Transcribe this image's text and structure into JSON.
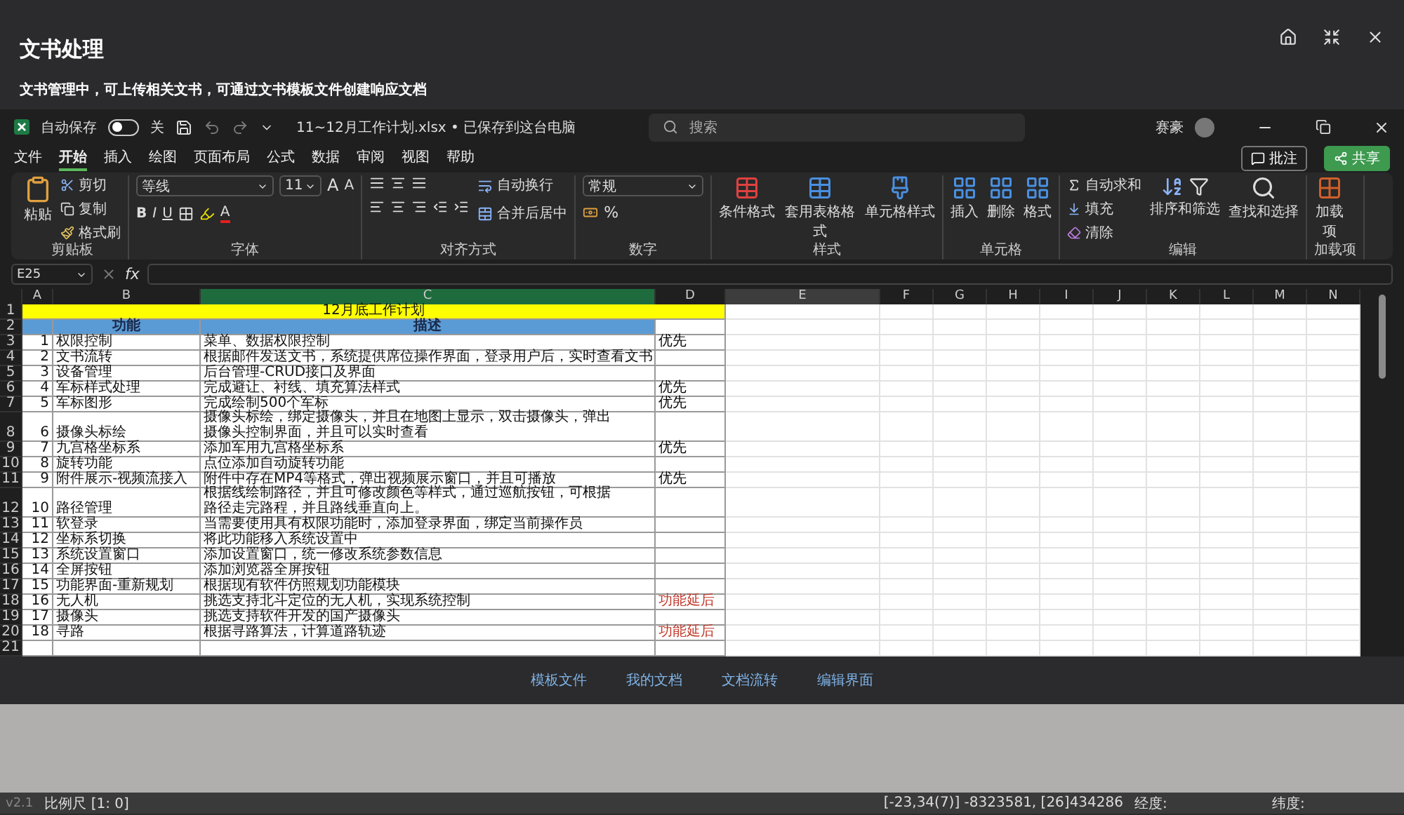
{
  "header": {
    "title": "文书处理",
    "subtitle": "文书管理中，可上传相关文书，可通过文书模板文件创建响应文档"
  },
  "excel": {
    "autosave": {
      "label": "自动保存",
      "on": false,
      "state_label": "关"
    },
    "filename": "11~12月工作计划.xlsx • 已保存到这台电脑",
    "search": {
      "placeholder": "搜索"
    },
    "user": "赛豪",
    "menu_tabs": [
      {
        "label": "文件",
        "selected": false
      },
      {
        "label": "开始",
        "selected": true
      },
      {
        "label": "插入",
        "selected": false
      },
      {
        "label": "绘图",
        "selected": false
      },
      {
        "label": "页面布局",
        "selected": false
      },
      {
        "label": "公式",
        "selected": false
      },
      {
        "label": "数据",
        "selected": false
      },
      {
        "label": "审阅",
        "selected": false
      },
      {
        "label": "视图",
        "selected": false
      },
      {
        "label": "帮助",
        "selected": false
      }
    ],
    "comment_button": "批注",
    "share_button": "共享",
    "ribbon": {
      "clipboard": {
        "label": "剪贴板",
        "paste": "粘贴",
        "cut": "剪切",
        "copy": "复制",
        "painter": "格式刷"
      },
      "font": {
        "label": "字体",
        "font_name": "等线",
        "font_size": "11",
        "grow": "A",
        "shrink": "A",
        "styles": [
          "B",
          "I",
          "U"
        ],
        "color_glyph": "A"
      },
      "alignment": {
        "label": "对齐方式",
        "wrap": "自动换行",
        "merge": "合并后居中"
      },
      "number": {
        "label": "数字",
        "format": "常规",
        "percent": "%"
      },
      "styles": {
        "label": "样式",
        "conditional": "条件格式",
        "table": "套用表格格式",
        "cell_styles": "单元格样式"
      },
      "cells": {
        "label": "单元格",
        "insert": "插入",
        "delete": "删除",
        "format": "格式"
      },
      "editing": {
        "label": "编辑",
        "autosum": "自动求和",
        "fill": "填充",
        "clear": "清除",
        "sort": "排序和筛选",
        "find": "查找和选择"
      },
      "addins": {
        "label": "加载项",
        "button": "加载项"
      }
    },
    "formula_bar": {
      "name_box": "E25",
      "fx": "fx"
    },
    "sheet": {
      "columns": [
        {
          "letter": "A",
          "kind": "normal"
        },
        {
          "letter": "B",
          "kind": "normal"
        },
        {
          "letter": "C",
          "kind": "filled"
        },
        {
          "letter": "D",
          "kind": "normal"
        },
        {
          "letter": "E",
          "kind": "active"
        },
        {
          "letter": "F",
          "kind": "normal"
        },
        {
          "letter": "G",
          "kind": "normal"
        },
        {
          "letter": "H",
          "kind": "normal"
        },
        {
          "letter": "I",
          "kind": "normal"
        },
        {
          "letter": "J",
          "kind": "normal"
        },
        {
          "letter": "K",
          "kind": "normal"
        },
        {
          "letter": "L",
          "kind": "normal"
        },
        {
          "letter": "M",
          "kind": "normal"
        },
        {
          "letter": "N",
          "kind": "normal"
        }
      ],
      "title_row": {
        "number": "1",
        "text": "12月底工作计划"
      },
      "head_row": {
        "number": "2",
        "col_b": "功能",
        "col_c": "描述"
      },
      "rows": [
        {
          "number": "3",
          "index": "1",
          "name": "权限控制",
          "desc": "菜单、数据权限控制",
          "wrap": false,
          "note": {
            "text": "优先",
            "color": "#000000"
          }
        },
        {
          "number": "4",
          "index": "2",
          "name": "文书流转",
          "desc": "根据邮件发送文书，系统提供席位操作界面，登录用户后，实时查看文书",
          "wrap": false
        },
        {
          "number": "5",
          "index": "3",
          "name": "设备管理",
          "desc": "后台管理-CRUD接口及界面",
          "wrap": false
        },
        {
          "number": "6",
          "index": "4",
          "name": "军标样式处理",
          "desc": "完成避让、衬线、填充算法样式",
          "wrap": false,
          "note": {
            "text": "优先",
            "color": "#000000"
          }
        },
        {
          "number": "7",
          "index": "5",
          "name": "军标图形",
          "desc": "完成绘制500个军标",
          "wrap": false,
          "note": {
            "text": "优先",
            "color": "#000000"
          }
        },
        {
          "number": "8",
          "index": "6",
          "name": "摄像头标绘",
          "desc": "摄像头标绘，绑定摄像头，并且在地图上显示，双击摄像头，弹出摄像头控制界面，并且可以实时查看",
          "wrap": true
        },
        {
          "number": "9",
          "index": "7",
          "name": "九宫格坐标系",
          "desc": "添加军用九宫格坐标系",
          "wrap": false,
          "note": {
            "text": "优先",
            "color": "#000000"
          }
        },
        {
          "number": "10",
          "index": "8",
          "name": "旋转功能",
          "desc": "点位添加自动旋转功能",
          "wrap": false
        },
        {
          "number": "11",
          "index": "9",
          "name": "附件展示-视频流接入",
          "desc": "附件中存在MP4等格式，弹出视频展示窗口，并且可播放",
          "wrap": false,
          "note": {
            "text": "优先",
            "color": "#000000"
          }
        },
        {
          "number": "12",
          "index": "10",
          "name": "路径管理",
          "desc": "根据线绘制路径，并且可修改颜色等样式，通过巡航按钮，可根据路径走完路程，并且路线垂直向上。",
          "wrap": true
        },
        {
          "number": "13",
          "index": "11",
          "name": "软登录",
          "desc": "当需要使用具有权限功能时，添加登录界面，绑定当前操作员",
          "wrap": false
        },
        {
          "number": "14",
          "index": "12",
          "name": "坐标系切换",
          "desc": "将此功能移入系统设置中",
          "wrap": false
        },
        {
          "number": "15",
          "index": "13",
          "name": "系统设置窗口",
          "desc": "添加设置窗口，统一修改系统参数信息",
          "wrap": false
        },
        {
          "number": "16",
          "index": "14",
          "name": "全屏按钮",
          "desc": "添加浏览器全屏按钮",
          "wrap": false
        },
        {
          "number": "17",
          "index": "15",
          "name": "功能界面-重新规划",
          "desc": "根据现有软件仿照规划功能模块",
          "wrap": false
        },
        {
          "number": "18",
          "index": "16",
          "name": "无人机",
          "desc": "挑选支持北斗定位的无人机，实现系统控制",
          "wrap": false,
          "note": {
            "text": "功能延后",
            "color": "#c0392b"
          }
        },
        {
          "number": "19",
          "index": "17",
          "name": "摄像头",
          "desc": "挑选支持软件开发的国产摄像头",
          "wrap": false
        },
        {
          "number": "20",
          "index": "18",
          "name": "寻路",
          "desc": "根据寻路算法，计算道路轨迹",
          "wrap": false,
          "note": {
            "text": "功能延后",
            "color": "#c0392b"
          }
        }
      ],
      "empty_rows": [
        "21"
      ]
    }
  },
  "nav_links": [
    "模板文件",
    "我的文档",
    "文档流转",
    "编辑界面"
  ],
  "status_bar": {
    "version": "v2.1",
    "scale": "比例尺 [1: 0]",
    "coords": "[-23,34(7)] -8323581, [26]434286",
    "longitude": "经度:",
    "latitude": "纬度:"
  }
}
